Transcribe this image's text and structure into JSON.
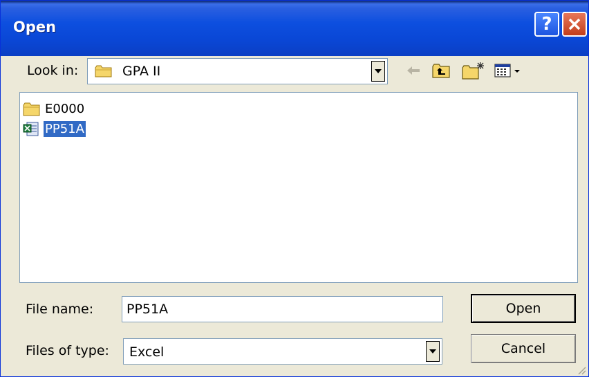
{
  "window": {
    "title": "Open"
  },
  "lookin": {
    "label": "Look in:",
    "value": "GPA II"
  },
  "files": [
    {
      "name": "E0000",
      "type": "folder",
      "selected": false
    },
    {
      "name": "PP51A",
      "type": "excel",
      "selected": true
    }
  ],
  "filename": {
    "label": "File name:",
    "value": "PP51A"
  },
  "filetype": {
    "label": "Files of type:",
    "value": "Excel"
  },
  "buttons": {
    "open": "Open",
    "cancel": "Cancel"
  },
  "icons": {
    "help": "?",
    "close": "close-icon",
    "back": "back-arrow-icon",
    "up": "up-folder-icon",
    "newfolder": "new-folder-icon",
    "view": "view-menu-icon"
  },
  "colors": {
    "titlebar": "#0a47d6",
    "selection": "#316ac5",
    "dialog": "#ece9d8"
  }
}
